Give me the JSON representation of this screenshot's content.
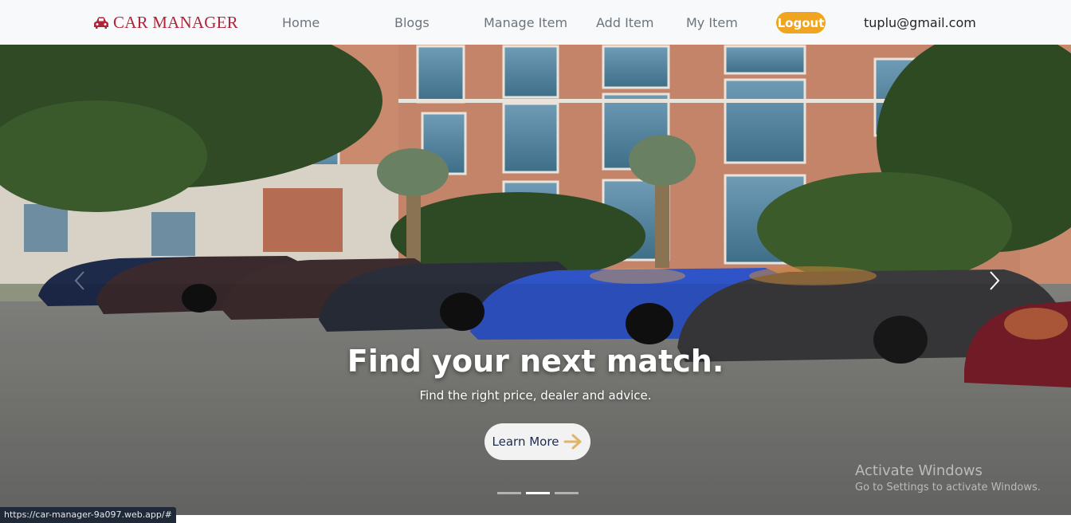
{
  "navbar": {
    "brand": "CAR MANAGER",
    "links": [
      "Home",
      "Blogs",
      "Manage Item",
      "Add Item",
      "My Item"
    ],
    "logout_label": "Logout",
    "user_email": "tuplu@gmail.com"
  },
  "hero": {
    "title": "Find your next match.",
    "subtitle": "Find the right price, dealer and advice.",
    "cta_label": "Learn More",
    "active_slide": 2,
    "slide_count": 3
  },
  "watermark": {
    "line1": "Activate Windows",
    "line2": "Go to Settings to activate Windows."
  },
  "status_url": "https://car-manager-9a097.web.app/#",
  "colors": {
    "brand": "#b0243a",
    "logout_bg": "#f0a520",
    "arrow": "#e0b56a"
  },
  "icons": {
    "brand": "car-icon",
    "cta": "arrow-right-icon",
    "next": "chevron-right-icon",
    "prev": "chevron-left-icon"
  }
}
